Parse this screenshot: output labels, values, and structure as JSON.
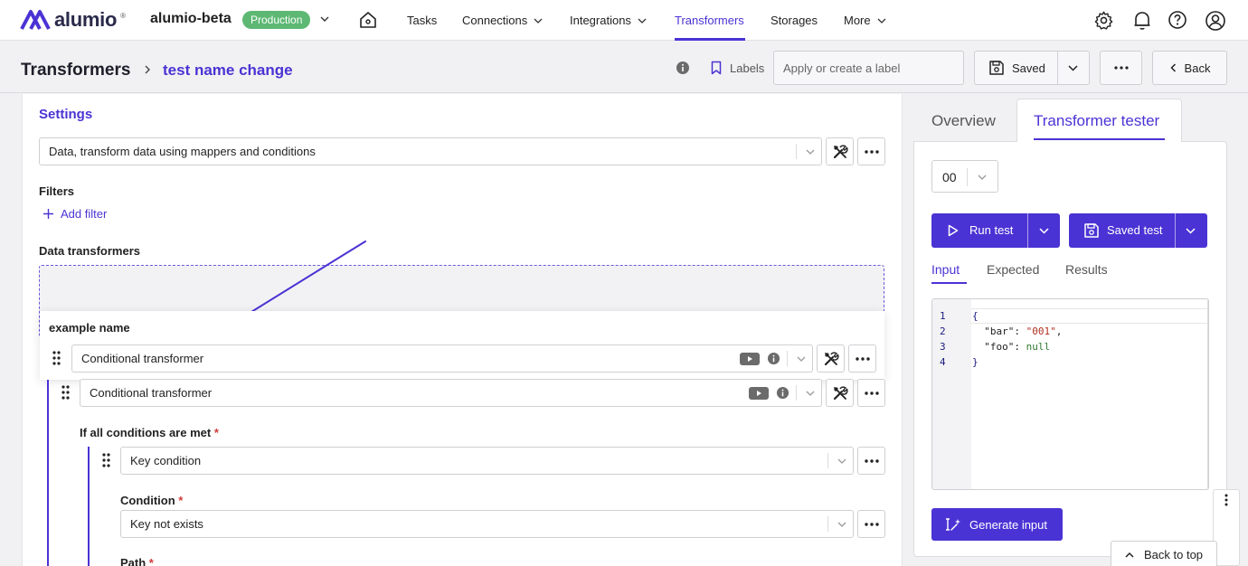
{
  "nav": {
    "brand": "alumio",
    "workspace": "alumio-beta",
    "environment": "Production",
    "items": [
      {
        "label": "Tasks"
      },
      {
        "label": "Connections"
      },
      {
        "label": "Integrations"
      },
      {
        "label": "Transformers"
      },
      {
        "label": "Storages"
      },
      {
        "label": "More"
      }
    ],
    "active_item": "Transformers",
    "icons": [
      "home-icon",
      "settings-gear-icon",
      "bell-icon",
      "help-icon",
      "user-icon"
    ]
  },
  "header": {
    "breadcrumb_root": "Transformers",
    "breadcrumb_current": "test name change",
    "labels_text": "Labels",
    "label_placeholder": "Apply or create a label",
    "saved_label": "Saved",
    "back_label": "Back"
  },
  "settings": {
    "title": "Settings",
    "transformer_type": "Data, transform data using mappers and conditions",
    "filters_label": "Filters",
    "add_filter_label": "Add filter",
    "data_transformers_label": "Data transformers",
    "dragging_item": {
      "name": "example name",
      "type": "Conditional transformer"
    },
    "transformer_item": {
      "type": "Conditional transformer"
    },
    "conditions_label": "If all conditions are met",
    "condition_select": "Key condition",
    "condition_label": "Condition",
    "condition_value": "Key not exists",
    "path_label": "Path"
  },
  "tester": {
    "tabs": [
      {
        "label": "Overview"
      },
      {
        "label": "Transformer tester"
      }
    ],
    "active_tab": "Transformer tester",
    "index_value": "00",
    "run_test_label": "Run test",
    "saved_test_label": "Saved test",
    "subtabs": [
      {
        "label": "Input"
      },
      {
        "label": "Expected"
      },
      {
        "label": "Results"
      }
    ],
    "active_subtab": "Input",
    "code_lines": [
      {
        "num": "1",
        "text": "{"
      },
      {
        "num": "2",
        "key": "\"bar\"",
        "value": "\"001\"",
        "suffix": ","
      },
      {
        "num": "3",
        "key": "\"foo\"",
        "value": "null",
        "suffix": ""
      },
      {
        "num": "4",
        "text": "}"
      }
    ],
    "generate_input_label": "Generate input",
    "back_to_top_label": "Back to top"
  },
  "colors": {
    "accent": "#4a33d4",
    "production_badge": "#5db873",
    "required": "#d23b3b"
  }
}
